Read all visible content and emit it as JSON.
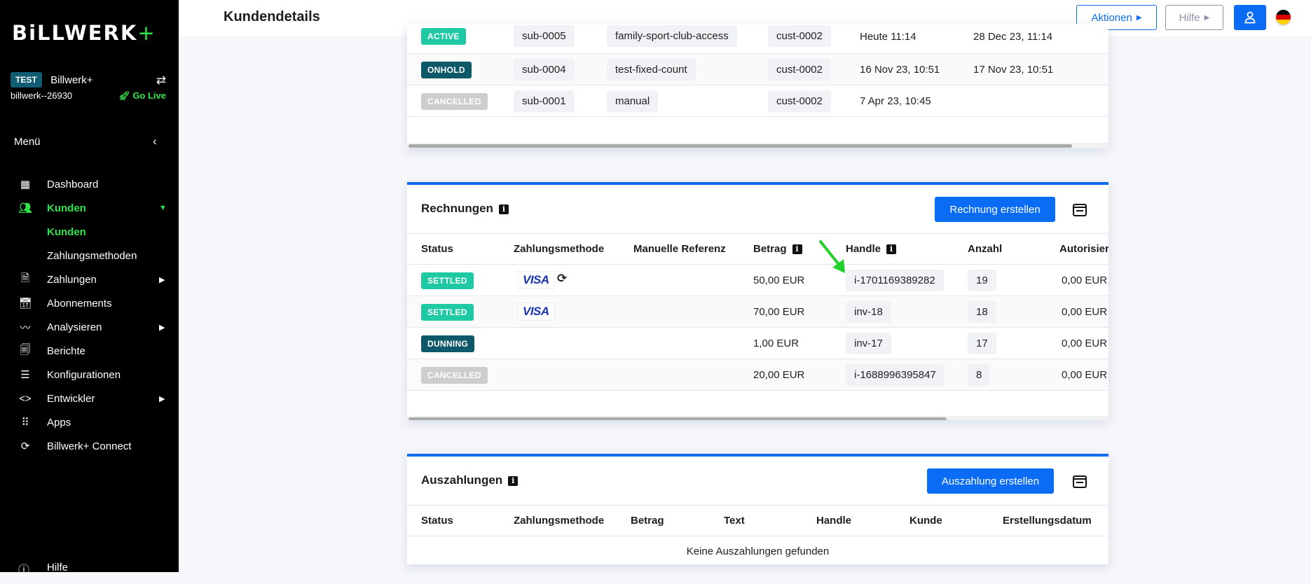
{
  "sidebar": {
    "logo": "BiLLWERK",
    "logo_plus": "+",
    "account": {
      "badge": "TEST",
      "name": "Billwerk+",
      "id": "billwerk--26930",
      "go_live": "Go Live"
    },
    "menu_label": "Menü",
    "items": [
      {
        "label": "Dashboard",
        "icon": "grid-icon"
      },
      {
        "label": "Kunden",
        "icon": "users-icon",
        "active": true,
        "expanded": true
      },
      {
        "label": "Kunden",
        "sub": true,
        "active": true
      },
      {
        "label": "Zahlungsmethoden",
        "sub": true
      },
      {
        "label": "Zahlungen",
        "icon": "document-icon",
        "has_children": true
      },
      {
        "label": "Abonnements",
        "icon": "calendar-clock-icon"
      },
      {
        "label": "Analysieren",
        "icon": "pulse-icon",
        "has_children": true
      },
      {
        "label": "Berichte",
        "icon": "report-icon"
      },
      {
        "label": "Konfigurationen",
        "icon": "sliders-icon"
      },
      {
        "label": "Entwickler",
        "icon": "code-icon",
        "has_children": true
      },
      {
        "label": "Apps",
        "icon": "apps-icon"
      },
      {
        "label": "Billwerk+ Connect",
        "icon": "sync-icon"
      }
    ],
    "help": "Hilfe"
  },
  "header": {
    "title": "Kundendetails",
    "actions_label": "Aktionen",
    "help_label": "Hilfe",
    "language": "DE"
  },
  "subscriptions": {
    "rows": [
      {
        "status": "ACTIVE",
        "handle": "sub-0005",
        "plan": "family-sport-club-access",
        "customer": "cust-0002",
        "created": "Heute 11:14",
        "next": "28 Dec 23, 11:14"
      },
      {
        "status": "ONHOLD",
        "handle": "sub-0004",
        "plan": "test-fixed-count",
        "customer": "cust-0002",
        "created": "16 Nov 23, 10:51",
        "next": "17 Nov 23, 10:51"
      },
      {
        "status": "CANCELLED",
        "handle": "sub-0001",
        "plan": "manual",
        "customer": "cust-0002",
        "created": "7 Apr 23, 10:45",
        "next": ""
      }
    ],
    "scroll_fraction": 0.95
  },
  "invoices": {
    "title": "Rechnungen",
    "create_label": "Rechnung erstellen",
    "columns": [
      "Status",
      "Zahlungsmethode",
      "Manuelle Referenz",
      "Betrag",
      "Handle",
      "Anzahl",
      "Autorisier"
    ],
    "rows": [
      {
        "status": "SETTLED",
        "method": "VISA",
        "recurring": true,
        "reference": "",
        "amount": "50,00 EUR",
        "handle": "i-1701169389282",
        "count": "19",
        "authorized": "0,00 EUR"
      },
      {
        "status": "SETTLED",
        "method": "VISA",
        "recurring": false,
        "reference": "",
        "amount": "70,00 EUR",
        "handle": "inv-18",
        "count": "18",
        "authorized": "0,00 EUR"
      },
      {
        "status": "DUNNING",
        "method": "",
        "recurring": false,
        "reference": "",
        "amount": "1,00 EUR",
        "handle": "inv-17",
        "count": "17",
        "authorized": "0,00 EUR"
      },
      {
        "status": "CANCELLED",
        "method": "",
        "recurring": false,
        "reference": "",
        "amount": "20,00 EUR",
        "handle": "i-1688996395847",
        "count": "8",
        "authorized": "0,00 EUR"
      }
    ],
    "scroll_fraction": 0.77
  },
  "payouts": {
    "title": "Auszahlungen",
    "create_label": "Auszahlung erstellen",
    "columns": [
      "Status",
      "Zahlungsmethode",
      "Betrag",
      "Text",
      "Handle",
      "Kunde",
      "Erstellungsdatum"
    ],
    "empty": "Keine Auszahlungen gefunden"
  },
  "colors": {
    "accent": "#0a6cf5",
    "brand_green": "#2ee64a",
    "settled": "#1ec9a3",
    "dunning": "#0d5869",
    "cancelled": "#cdcdcd"
  }
}
